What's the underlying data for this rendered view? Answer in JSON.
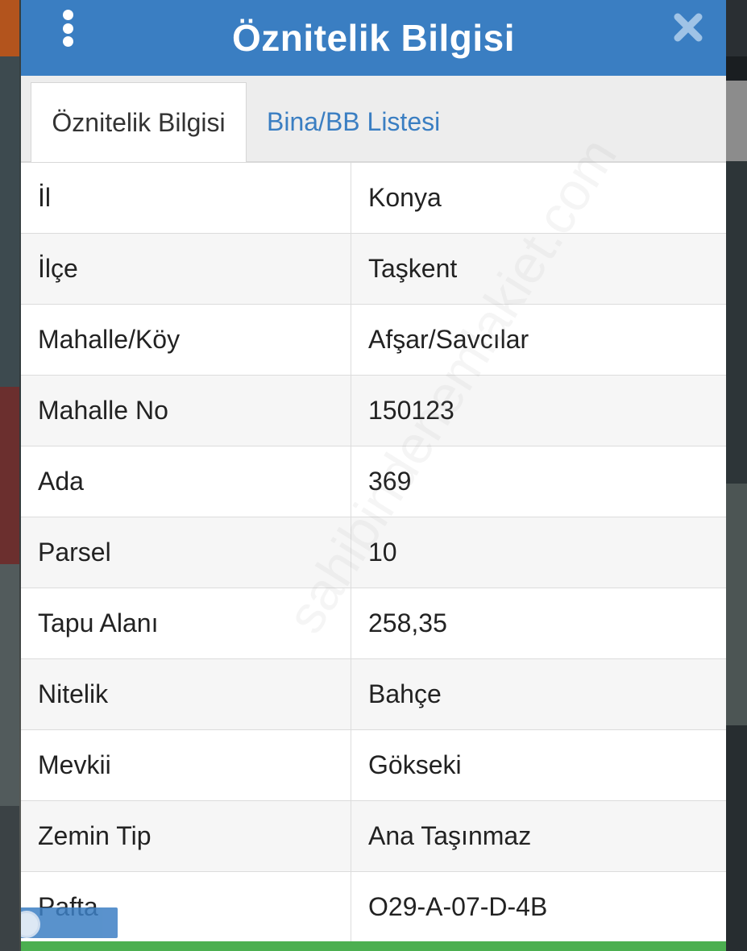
{
  "dialog": {
    "title": "Öznitelik Bilgisi"
  },
  "tabs": [
    {
      "label": "Öznitelik Bilgisi",
      "active": true
    },
    {
      "label": "Bina/BB Listesi",
      "active": false
    }
  ],
  "attributes": [
    {
      "label": "İl",
      "value": "Konya"
    },
    {
      "label": "İlçe",
      "value": "Taşkent"
    },
    {
      "label": "Mahalle/Köy",
      "value": "Afşar/Savcılar"
    },
    {
      "label": "Mahalle No",
      "value": "150123"
    },
    {
      "label": "Ada",
      "value": "369"
    },
    {
      "label": "Parsel",
      "value": "10"
    },
    {
      "label": "Tapu Alanı",
      "value": "258,35"
    },
    {
      "label": "Nitelik",
      "value": "Bahçe"
    },
    {
      "label": "Mevkii",
      "value": "Gökseki"
    },
    {
      "label": "Zemin Tip",
      "value": "Ana Taşınmaz"
    },
    {
      "label": "Pafta",
      "value": "O29-A-07-D-4B"
    }
  ],
  "watermark": "sahibindenemlakiet.com",
  "colors": {
    "header": "#3a7ec2",
    "tab_link": "#3a7ec2",
    "footer_bar": "#4caf50"
  }
}
